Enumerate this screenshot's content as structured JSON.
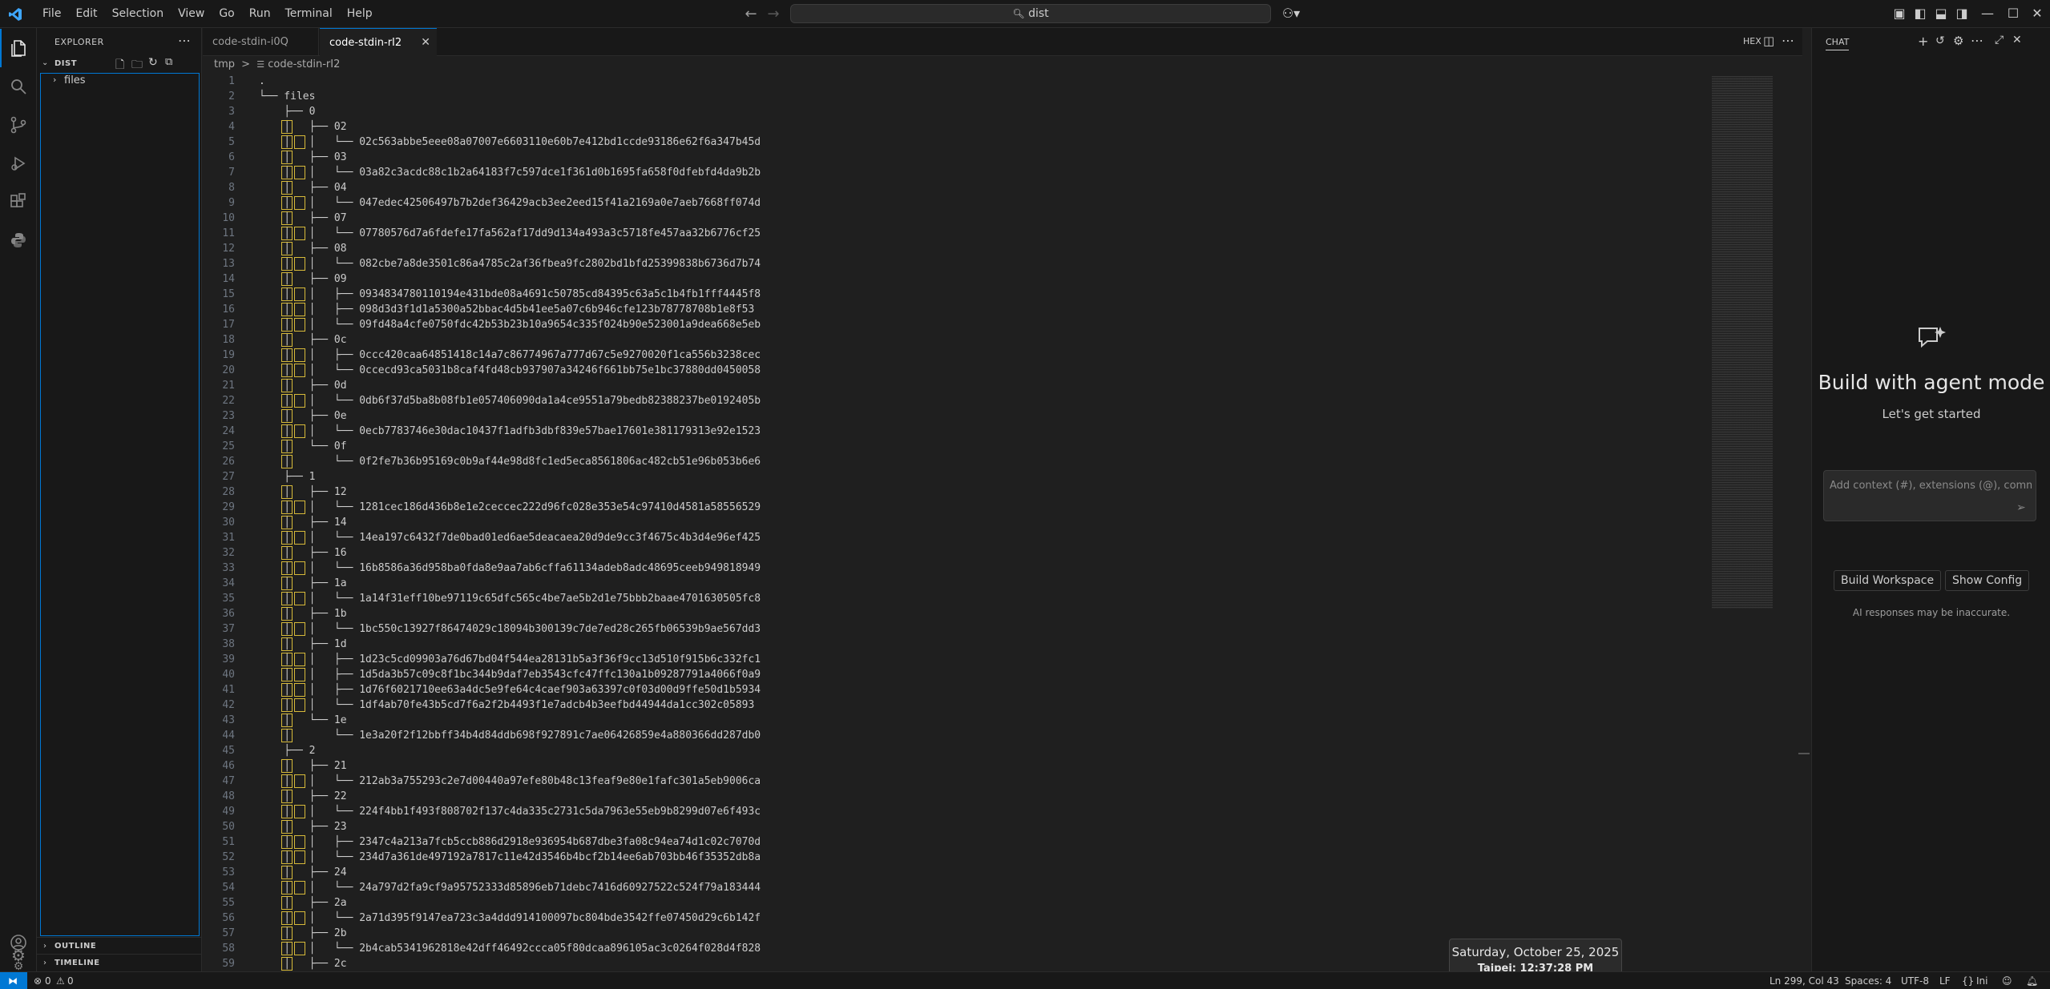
{
  "menu": [
    "File",
    "Edit",
    "Selection",
    "View",
    "Go",
    "Run",
    "Terminal",
    "Help"
  ],
  "search": {
    "text": "dist"
  },
  "sidebar": {
    "header": "EXPLORER",
    "section": "DIST",
    "tree": [
      {
        "label": "files"
      }
    ],
    "outline": "OUTLINE",
    "timeline": "TIMELINE"
  },
  "tabs": [
    {
      "label": "code-stdin-i0Q",
      "active": false
    },
    {
      "label": "code-stdin-rI2",
      "active": true
    }
  ],
  "breadcrumb": {
    "part1": "tmp",
    "sep": ">",
    "part2": "code-stdin-rI2"
  },
  "editor": {
    "hex_label": "HEX",
    "lines": [
      ".",
      "└── files",
      "    ├── 0",
      "    │   ├── 02",
      "    │   │   └── 02c563abbe5eee08a07007e6603110e60b7e412bd1ccde93186e62f6a347b45d",
      "    │   ├── 03",
      "    │   │   └── 03a82c3acdc88c1b2a64183f7c597dce1f361d0b1695fa658f0dfebfd4da9b2b",
      "    │   ├── 04",
      "    │   │   └── 047edec42506497b7b2def36429acb3ee2eed15f41a2169a0e7aeb7668ff074d",
      "    │   ├── 07",
      "    │   │   └── 07780576d7a6fdefe17fa562af17dd9d134a493a3c5718fe457aa32b6776cf25",
      "    │   ├── 08",
      "    │   │   └── 082cbe7a8de3501c86a4785c2af36fbea9fc2802bd1bfd25399838b6736d7b74",
      "    │   ├── 09",
      "    │   │   ├── 0934834780110194e431bde08a4691c50785cd84395c63a5c1b4fb1fff4445f8",
      "    │   │   ├── 098d3d3f1d1a5300a52bbac4d5b41ee5a07c6b946cfe123b78778708b1e8f53",
      "    │   │   └── 09fd48a4cfe0750fdc42b53b23b10a9654c335f024b90e523001a9dea668e5eb",
      "    │   ├── 0c",
      "    │   │   ├── 0ccc420caa64851418c14a7c86774967a777d67c5e9270020f1ca556b3238cec",
      "    │   │   └── 0ccecd93ca5031b8caf4fd48cb937907a34246f661bb75e1bc37880dd0450058",
      "    │   ├── 0d",
      "    │   │   └── 0db6f37d5ba8b08fb1e057406090da1a4ce9551a79bedb82388237be0192405b",
      "    │   ├── 0e",
      "    │   │   └── 0ecb7783746e30dac10437f1adfb3dbf839e57bae17601e381179313e92e1523",
      "    │   └── 0f",
      "    │       └── 0f2fe7b36b95169c0b9af44e98d8fc1ed5eca8561806ac482cb51e96b053b6e6",
      "    ├── 1",
      "    │   ├── 12",
      "    │   │   └── 1281cec186d436b8e1e2ceccec222d96fc028e353e54c97410d4581a58556529",
      "    │   ├── 14",
      "    │   │   └── 14ea197c6432f7de0bad01ed6ae5deacaea20d9de9cc3f4675c4b3d4e96ef425",
      "    │   ├── 16",
      "    │   │   └── 16b8586a36d958ba0fda8e9aa7ab6cffa61134adeb8adc48695ceeb949818949",
      "    │   ├── 1a",
      "    │   │   └── 1a14f31eff10be97119c65dfc565c4be7ae5b2d1e75bbb2baae4701630505fc8",
      "    │   ├── 1b",
      "    │   │   └── 1bc550c13927f86474029c18094b300139c7de7ed28c265fb06539b9ae567dd3",
      "    │   ├── 1d",
      "    │   │   ├── 1d23c5cd09903a76d67bd04f544ea28131b5a3f36f9cc13d510f915b6c332fc1",
      "    │   │   ├── 1d5da3b57c09c8f1bc344b9daf7eb3543cfc47ffc130a1b09287791a4066f0a9",
      "    │   │   ├── 1d76f6021710ee63a4dc5e9fe64c4caef903a63397c0f03d00d9ffe50d1b5934",
      "    │   │   └── 1df4ab70fe43b5cd7f6a2f2b4493f1e7adcb4b3eefbd44944da1cc302c05893",
      "    │   └── 1e",
      "    │       └── 1e3a20f2f12bbff34b4d84ddb698f927891c7ae06426859e4a880366dd287db0",
      "    ├── 2",
      "    │   ├── 21",
      "    │   │   └── 212ab3a755293c2e7d00440a97efe80b48c13feaf9e80e1fafc301a5eb9006ca",
      "    │   ├── 22",
      "    │   │   └── 224f4bb1f493f808702f137c4da335c2731c5da7963e55eb9b8299d07e6f493c",
      "    │   ├── 23",
      "    │   │   ├── 2347c4a213a7fcb5ccb886d2918e936954b687dbe3fa08c94ea74d1c02c7070d",
      "    │   │   └── 234d7a361de497192a7817c11e42d3546b4bcf2b14ee6ab703bb46f35352db8a",
      "    │   ├── 24",
      "    │   │   └── 24a797d2fa9cf9a95752333d85896eb71debc7416d60927522c524f79a183444",
      "    │   ├── 2a",
      "    │   │   └── 2a71d395f9147ea723c3a4ddd914100097bc804bde3542ffe07450d29c6b142f",
      "    │   ├── 2b",
      "    │   │   └── 2b4cab5341962818e42dff46492ccca05f80dcaa896105ac3c0264f028d4f828",
      "    │   ├── 2c"
    ]
  },
  "chat": {
    "title": "CHAT",
    "heading": "Build with agent mode",
    "subheading": "Let's get started",
    "input_placeholder": "Add context (#), extensions (@), commands",
    "buttons": [
      "Build Workspace",
      "Show Config"
    ],
    "disclaimer": "AI responses may be inaccurate."
  },
  "statusbar": {
    "errors": "0",
    "warnings": "0",
    "position": "Ln 299, Col 43",
    "spaces": "Spaces: 4",
    "encoding": "UTF-8",
    "eol": "LF",
    "language": "Ini"
  },
  "clock": {
    "date": "Saturday, October 25, 2025",
    "city": "Taipei:",
    "time": "12:37:28 PM"
  },
  "colors": {
    "accent": "#0078d4",
    "guide": "#d7ba3a",
    "background": "#1f1f1f"
  }
}
